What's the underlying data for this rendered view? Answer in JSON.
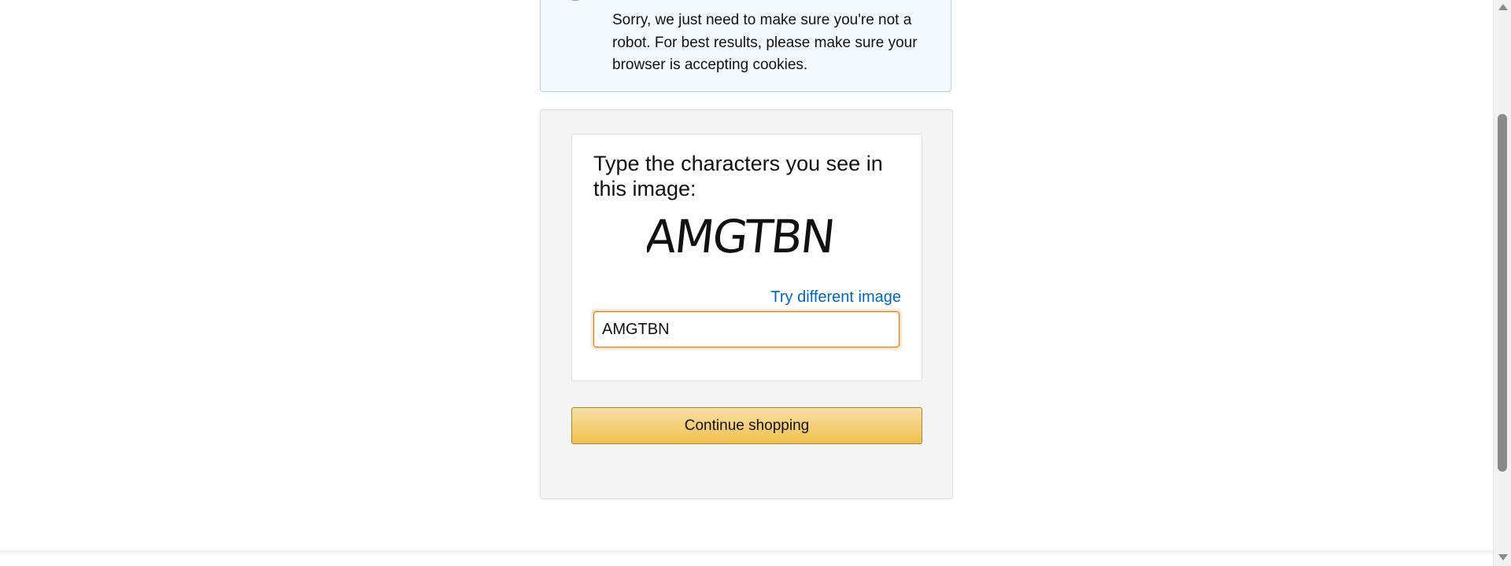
{
  "alert": {
    "icon": "info-circle-icon",
    "message": "Sorry, we just need to make sure you're not a robot. For best results, please make sure your browser is accepting cookies.",
    "border_color": "#aed4e8",
    "icon_color": "#5fa8d3"
  },
  "captcha": {
    "prompt": "Type the characters you see in this image:",
    "image_text": "AMGTBN",
    "try_different_label": "Try different image",
    "input_value": "AMGTBN",
    "input_focus_color": "#e77600"
  },
  "actions": {
    "continue_label": "Continue shopping",
    "button_color": "#f0c14b"
  },
  "colors": {
    "link": "#0066c0",
    "card_background": "#f4f4f4"
  }
}
